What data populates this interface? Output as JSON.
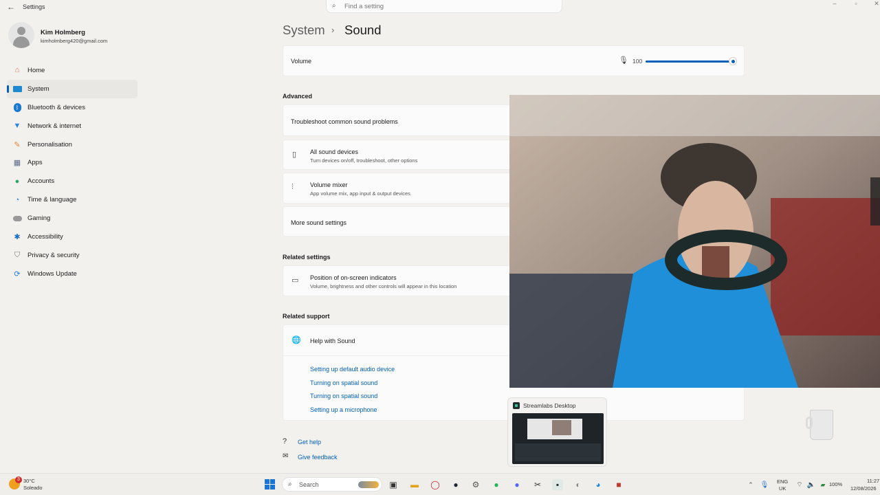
{
  "titlebar": {
    "app_title": "Settings",
    "search_placeholder": "Find a setting"
  },
  "user": {
    "name": "Kim Holmberg",
    "email": "kimholmberg420@gmail.com"
  },
  "nav": [
    {
      "label": "Home",
      "icon": "home-icon",
      "color": "#d9734f"
    },
    {
      "label": "System",
      "icon": "system-icon",
      "color": "#1e88d0",
      "active": true
    },
    {
      "label": "Bluetooth & devices",
      "icon": "bluetooth-icon",
      "color": "#1877d2"
    },
    {
      "label": "Network & internet",
      "icon": "wifi-icon",
      "color": "#2e86de"
    },
    {
      "label": "Personalisation",
      "icon": "brush-icon",
      "color": "#e0813a"
    },
    {
      "label": "Apps",
      "icon": "apps-icon",
      "color": "#5c6b8a"
    },
    {
      "label": "Accounts",
      "icon": "accounts-icon",
      "color": "#2fa86a"
    },
    {
      "label": "Time & language",
      "icon": "globe-clock-icon",
      "color": "#2b8ad6"
    },
    {
      "label": "Gaming",
      "icon": "gamepad-icon",
      "color": "#888888"
    },
    {
      "label": "Accessibility",
      "icon": "accessibility-icon",
      "color": "#1a6fc7"
    },
    {
      "label": "Privacy & security",
      "icon": "shield-icon",
      "color": "#7a7a7a"
    },
    {
      "label": "Windows Update",
      "icon": "update-icon",
      "color": "#1e7fd6"
    }
  ],
  "breadcrumb": {
    "parent": "System",
    "separator": "›",
    "current": "Sound"
  },
  "volume": {
    "label": "Volume",
    "value": "100",
    "level_percent": 100
  },
  "advanced": {
    "heading": "Advanced",
    "troubleshoot": "Troubleshoot common sound problems",
    "all_devices": {
      "title": "All sound devices",
      "sub": "Turn devices on/off, troubleshoot, other options"
    },
    "mixer": {
      "title": "Volume mixer",
      "sub": "App volume mix, app input & output devices"
    },
    "more": "More sound settings"
  },
  "related_settings": {
    "heading": "Related settings",
    "indicators": {
      "title": "Position of on-screen indicators",
      "sub": "Volume, brightness and other controls will appear in this location"
    }
  },
  "related_support": {
    "heading": "Related support",
    "help_title": "Help with Sound",
    "links": [
      "Setting up default audio device",
      "Turning on spatial sound",
      "Turning on spatial sound",
      "Setting up a microphone"
    ]
  },
  "footer": {
    "get_help": "Get help",
    "feedback": "Give feedback"
  },
  "preview": {
    "title": "Streamlabs Desktop"
  },
  "taskbar": {
    "weather_temp": "30°C",
    "weather_desc": "Soleado",
    "weather_badge": "3",
    "search_label": "Search",
    "lang_line1": "ENG",
    "lang_line2": "UK",
    "battery": "100%",
    "time": "11:27",
    "date": "12/08/2026"
  },
  "colors": {
    "accent": "#005fb8"
  }
}
